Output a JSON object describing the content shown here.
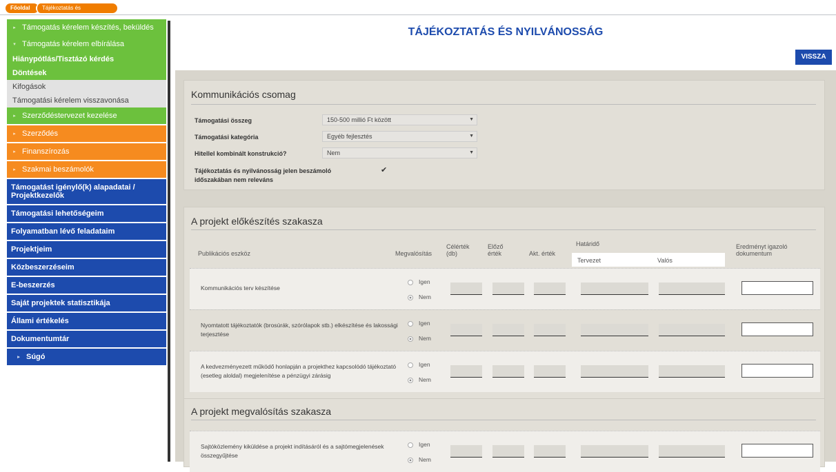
{
  "breadcrumb": {
    "home": "Főoldal",
    "current": "Tájékoztatás és nyilvánosság"
  },
  "sidebar": {
    "items": [
      {
        "label": "Támogatás kérelem készítés, beküldés",
        "color": "green",
        "arrow": "▸"
      },
      {
        "label": "Támogatás kérelem elbírálása",
        "color": "green",
        "arrow": "▾"
      },
      {
        "label": "Hiánypótlás/Tisztázó kérdés",
        "color": "sub"
      },
      {
        "label": "Döntések",
        "color": "sub"
      },
      {
        "label": "Kifogások",
        "color": "grey"
      },
      {
        "label": "Támogatási kérelem visszavonása",
        "color": "grey"
      },
      {
        "label": "Szerződéstervezet kezelése",
        "color": "green",
        "arrow": "▸"
      },
      {
        "label": "Szerződés",
        "color": "orange",
        "arrow": "▸"
      },
      {
        "label": "Finanszírozás",
        "color": "orange",
        "arrow": "▸"
      },
      {
        "label": "Szakmai beszámolók",
        "color": "orange",
        "arrow": "▸"
      },
      {
        "label": "Támogatást igénylő(k) alapadatai / Projektkezelők",
        "color": "blue"
      },
      {
        "label": "Támogatási lehetőségeim",
        "color": "blue"
      },
      {
        "label": "Folyamatban lévő feladataim",
        "color": "blue"
      },
      {
        "label": "Projektjeim",
        "color": "blue"
      },
      {
        "label": "Közbeszerzéseim",
        "color": "blue"
      },
      {
        "label": "E-beszerzés",
        "color": "blue"
      },
      {
        "label": "Saját projektek statisztikája",
        "color": "blue"
      },
      {
        "label": "Állami értékelés",
        "color": "blue"
      },
      {
        "label": "Dokumentumtár",
        "color": "blue"
      },
      {
        "label": "Súgó",
        "color": "blue",
        "arrow": "▸"
      }
    ]
  },
  "main": {
    "title": "TÁJÉKOZTATÁS ÉS NYILVÁNOSSÁG",
    "back_label": "VISSZA",
    "package": {
      "title": "Kommunikációs csomag",
      "fields": [
        {
          "label": "Támogatási összeg",
          "value": "150-500 millió Ft között"
        },
        {
          "label": "Támogatási kategória",
          "value": "Egyéb fejlesztés"
        },
        {
          "label": "Hitellel kombinált konstrukció?",
          "value": "Nem"
        }
      ],
      "checkbox_label_1": "Tájékoztatás és nyilvánosság jelen beszámoló",
      "checkbox_label_2": "időszakában nem releváns",
      "checkbox_mark": "✔"
    },
    "prep": {
      "title": "A projekt előkészítés szakasza",
      "headers": {
        "tool": "Publikációs eszköz",
        "realization": "Megvalósítás",
        "target": "Célérték (db)",
        "previous": "Előző érték",
        "current": "Akt. érték",
        "deadline": "Határidő",
        "planned": "Tervezet",
        "actual": "Valós",
        "doc": "Eredményt igazoló dokumentum"
      },
      "rows": [
        {
          "label": "Kommunikációs terv készítése",
          "yes": "Igen",
          "no": "Nem"
        },
        {
          "label": "Nyomtatott tájékoztatók (brosúrák, szórólapok stb.) elkészítése és lakossági terjesztése",
          "yes": "Igen",
          "no": "Nem"
        },
        {
          "label": "A kedvezményezett működő honlapján a projekthez kapcsolódó tájékoztató (esetleg aloldal) megjelenítése a pénzügyi zárásig",
          "yes": "Igen",
          "no": "Nem"
        }
      ]
    },
    "impl": {
      "title": "A projekt megvalósítás szakasza",
      "rows": [
        {
          "label": "Sajtóközlemény kiküldése a projekt indításáról és a sajtómegjelenések összegyűjtése",
          "yes": "Igen",
          "no": "Nem"
        }
      ]
    }
  }
}
